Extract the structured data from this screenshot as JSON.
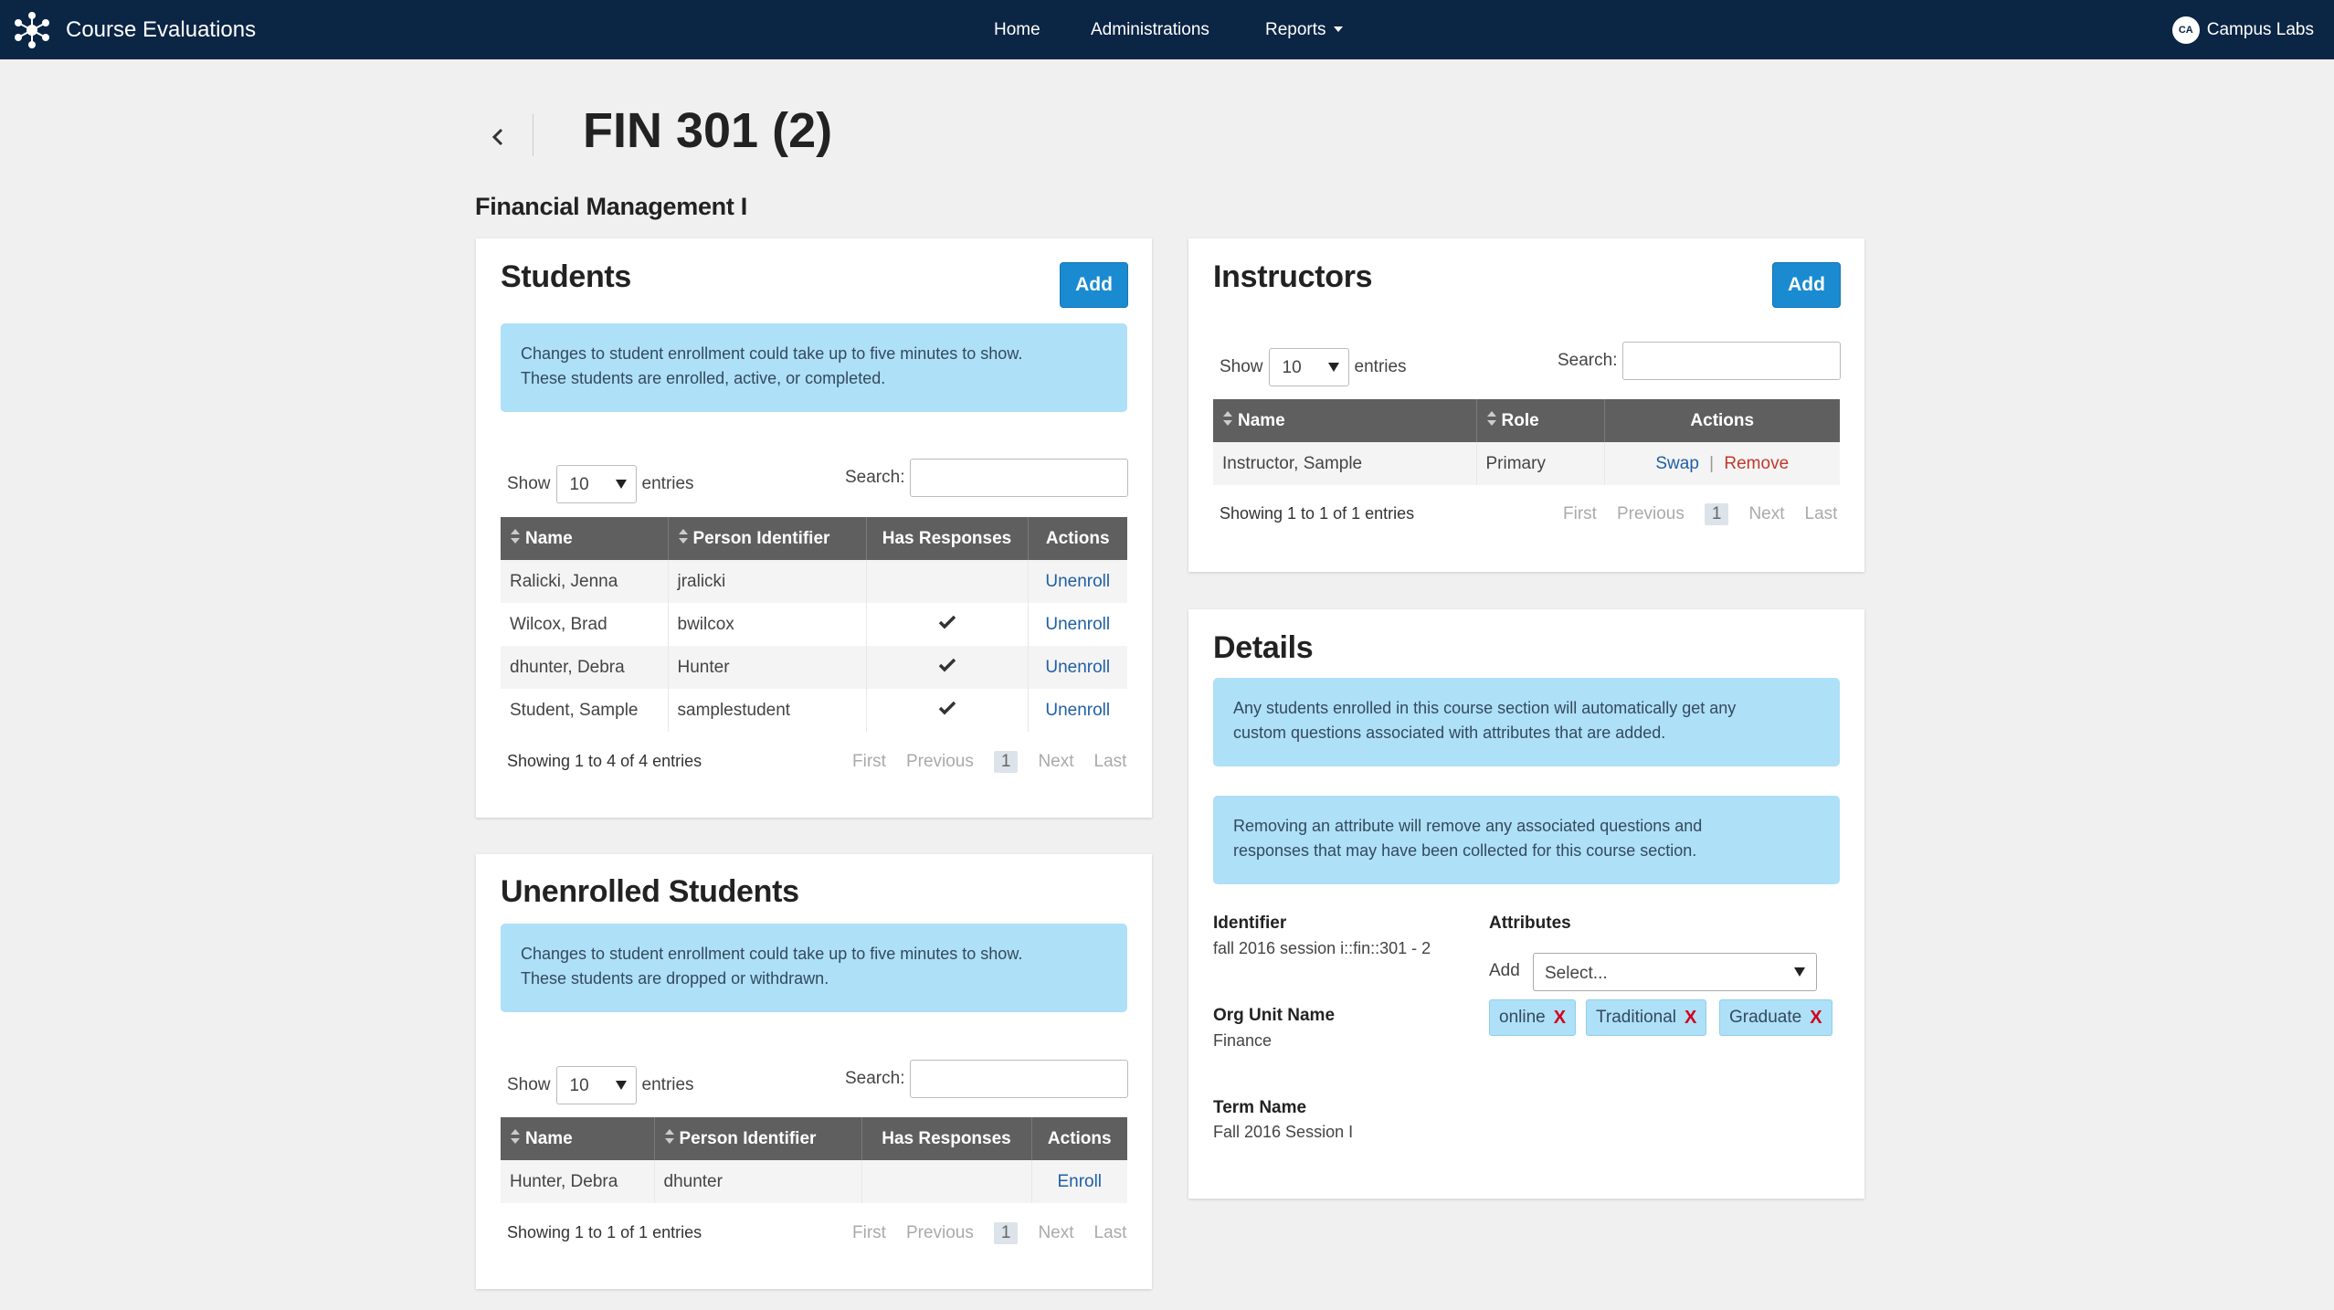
{
  "nav": {
    "app_title": "Course Evaluations",
    "links": [
      "Home",
      "Administrations",
      "Reports"
    ],
    "user_initials": "CA",
    "user_name": "Campus Labs"
  },
  "header": {
    "title": "FIN 301 (2)",
    "course_name": "Financial Management I"
  },
  "common": {
    "show": "Show",
    "entries": "entries",
    "search": "Search:",
    "add": "Add",
    "page_size": "10",
    "pager": {
      "first": "First",
      "previous": "Previous",
      "current": "1",
      "next": "Next",
      "last": "Last"
    }
  },
  "students": {
    "title": "Students",
    "alert_line1": "Changes to student enrollment could take up to five minutes to show.",
    "alert_line2": "These students are enrolled, active, or completed.",
    "columns": [
      "Name",
      "Person Identifier",
      "Has Responses",
      "Actions"
    ],
    "rows": [
      {
        "name": "Ralicki, Jenna",
        "id": "jralicki",
        "has_responses": false,
        "action": "Unenroll"
      },
      {
        "name": "Wilcox, Brad",
        "id": "bwilcox",
        "has_responses": true,
        "action": "Unenroll"
      },
      {
        "name": "dhunter, Debra",
        "id": "Hunter",
        "has_responses": true,
        "action": "Unenroll"
      },
      {
        "name": "Student, Sample",
        "id": "samplestudent",
        "has_responses": true,
        "action": "Unenroll"
      }
    ],
    "info": "Showing 1 to 4 of 4 entries"
  },
  "unenrolled": {
    "title": "Unenrolled Students",
    "alert_line1": "Changes to student enrollment could take up to five minutes to show.",
    "alert_line2": "These students are dropped or withdrawn.",
    "columns": [
      "Name",
      "Person Identifier",
      "Has Responses",
      "Actions"
    ],
    "rows": [
      {
        "name": "Hunter, Debra",
        "id": "dhunter",
        "has_responses": false,
        "action": "Enroll"
      }
    ],
    "info": "Showing 1 to 1 of 1 entries"
  },
  "instructors": {
    "title": "Instructors",
    "columns": [
      "Name",
      "Role",
      "Actions"
    ],
    "rows": [
      {
        "name": "Instructor, Sample",
        "role": "Primary",
        "action1": "Swap",
        "action2": "Remove"
      }
    ],
    "info": "Showing 1 to 1 of 1 entries"
  },
  "details": {
    "title": "Details",
    "alert1_line1": "Any students enrolled in this course section will automatically get any",
    "alert1_line2": "custom questions associated with attributes that are added.",
    "alert2_line1": "Removing an attribute will remove any associated questions and",
    "alert2_line2": "responses that may have been collected for this course section.",
    "identifier_label": "Identifier",
    "identifier_value": "fall 2016 session i::fin::301 - 2",
    "org_unit_label": "Org Unit Name",
    "org_unit_value": "Finance",
    "term_label": "Term Name",
    "term_value": "Fall 2016 Session I",
    "attributes_label": "Attributes",
    "add_label": "Add",
    "select_placeholder": "Select...",
    "tags": [
      "online",
      "Traditional",
      "Graduate"
    ],
    "tag_remove": "X"
  },
  "colors": {
    "navbar": "#0b2545",
    "primary_button": "#1a8bd1",
    "alert_bg": "#aee0f7",
    "table_header": "#5f5f5f",
    "link": "#1f5fa6",
    "danger": "#d0021b"
  }
}
